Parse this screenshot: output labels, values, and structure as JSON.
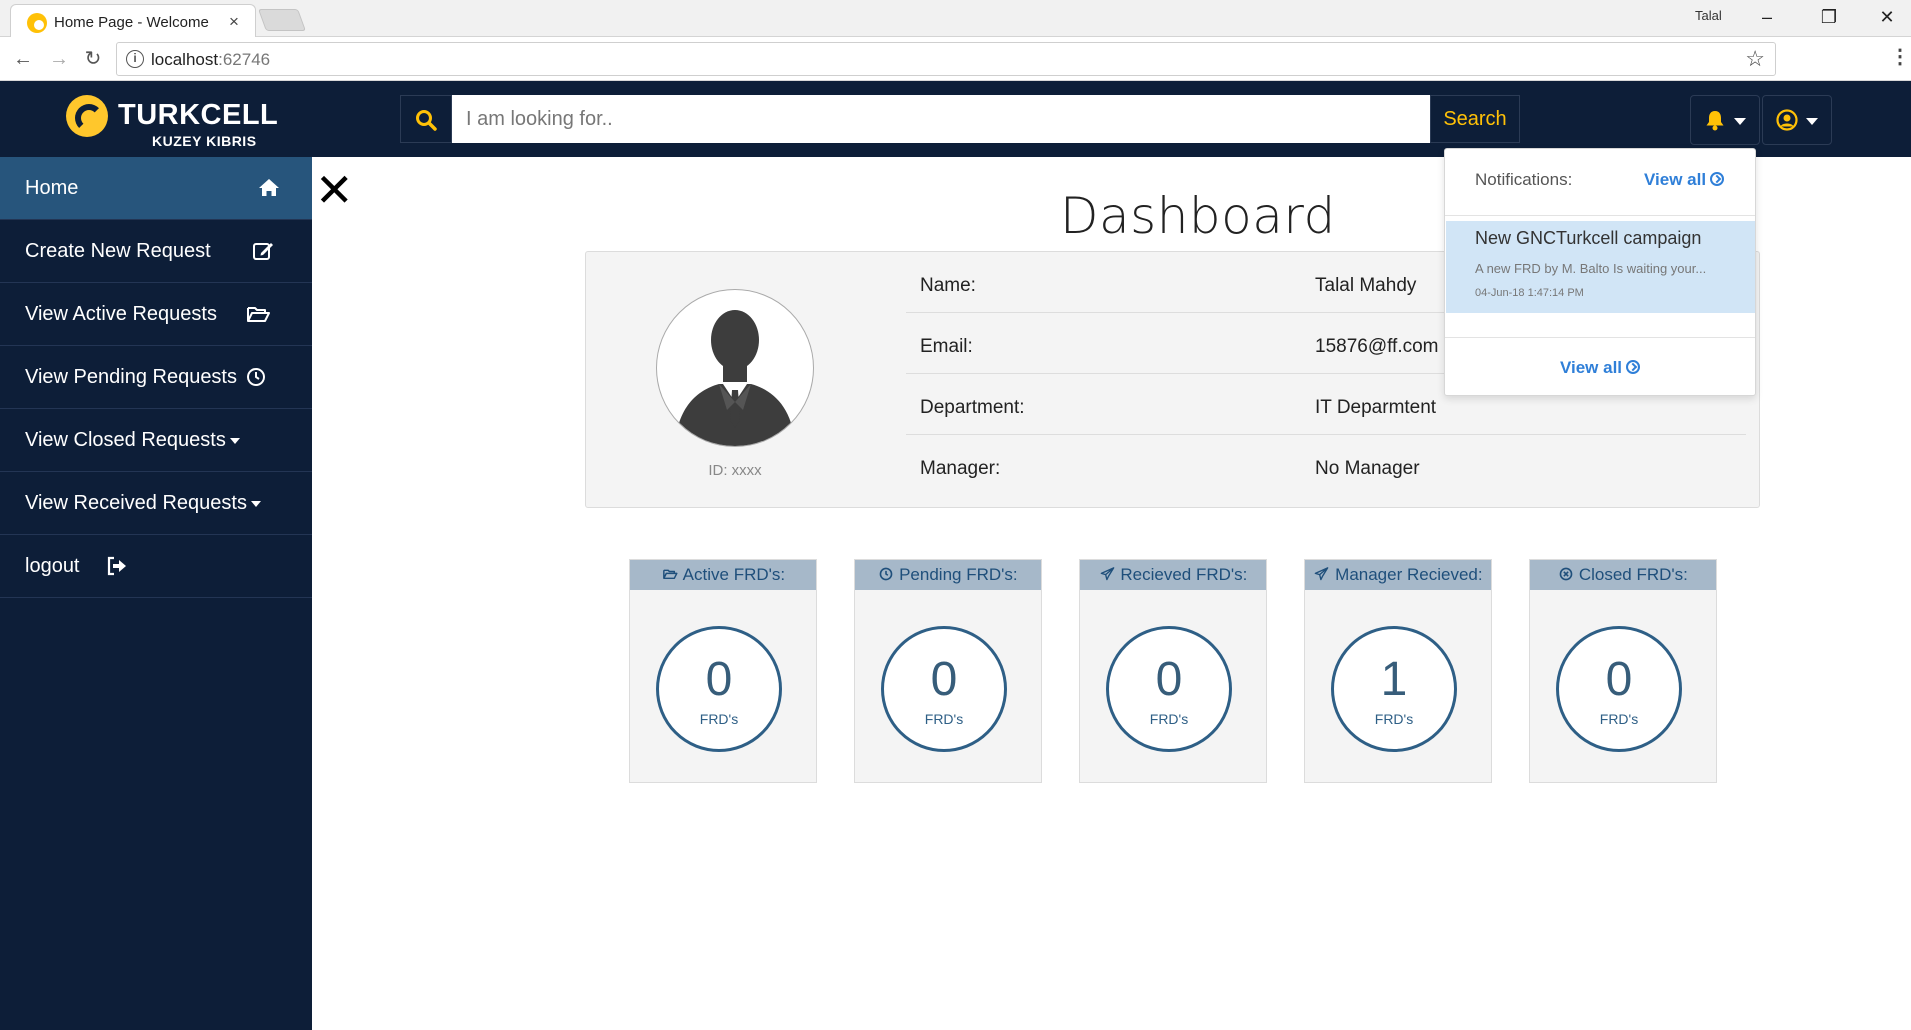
{
  "browser": {
    "tab_title": "Home Page - Welcome",
    "tab_close": "×",
    "window_user": "Talal",
    "url_host": "localhost",
    "url_port": ":62746"
  },
  "header": {
    "brand": "TURKCELL",
    "brand_sub": "KUZEY KIBRIS",
    "search_placeholder": "I am looking for..",
    "search_button": "Search"
  },
  "sidebar": {
    "items": [
      {
        "label": "Home",
        "icon": "home-icon"
      },
      {
        "label": "Create New Request",
        "icon": "edit-icon"
      },
      {
        "label": "View Active Requests",
        "icon": "folder-open-icon"
      },
      {
        "label": "View Pending Requests",
        "icon": "clock-icon"
      },
      {
        "label": "View Closed Requests",
        "icon": "caret-down-icon"
      },
      {
        "label": "View Received Requests",
        "icon": "caret-down-icon"
      },
      {
        "label": "logout",
        "icon": "sign-out-icon"
      }
    ]
  },
  "dashboard": {
    "title": "Dashboard",
    "profile": {
      "id_text": "ID: xxxx",
      "rows": [
        {
          "label": "Name:",
          "value": "Talal Mahdy"
        },
        {
          "label": "Email:",
          "value": "15876@ff.com"
        },
        {
          "label": "Department:",
          "value": "IT Deparmtent"
        },
        {
          "label": "Manager:",
          "value": "No Manager"
        }
      ]
    },
    "stats": [
      {
        "label": "Active FRD's:",
        "value": "0",
        "unit": "FRD's",
        "icon": "folder-open-icon"
      },
      {
        "label": "Pending FRD's:",
        "value": "0",
        "unit": "FRD's",
        "icon": "clock-icon"
      },
      {
        "label": "Recieved FRD's:",
        "value": "0",
        "unit": "FRD's",
        "icon": "paper-plane-icon"
      },
      {
        "label": "Manager Recieved:",
        "value": "1",
        "unit": "FRD's",
        "icon": "paper-plane-icon"
      },
      {
        "label": "Closed FRD's:",
        "value": "0",
        "unit": "FRD's",
        "icon": "times-circle-icon"
      }
    ]
  },
  "notifications": {
    "heading": "Notifications:",
    "view_all": "View all",
    "items": [
      {
        "title": "New GNCTurkcell campaign",
        "body": "A new FRD by M. Balto Is waiting your...",
        "time": "04-Jun-18 1:47:14 PM"
      }
    ]
  },
  "colors": {
    "navy": "#0d1e38",
    "active_blue": "#27557c",
    "accent_yellow": "#ffc107",
    "stat_header": "#a6b8c9",
    "link_blue": "#2f7fd8"
  }
}
